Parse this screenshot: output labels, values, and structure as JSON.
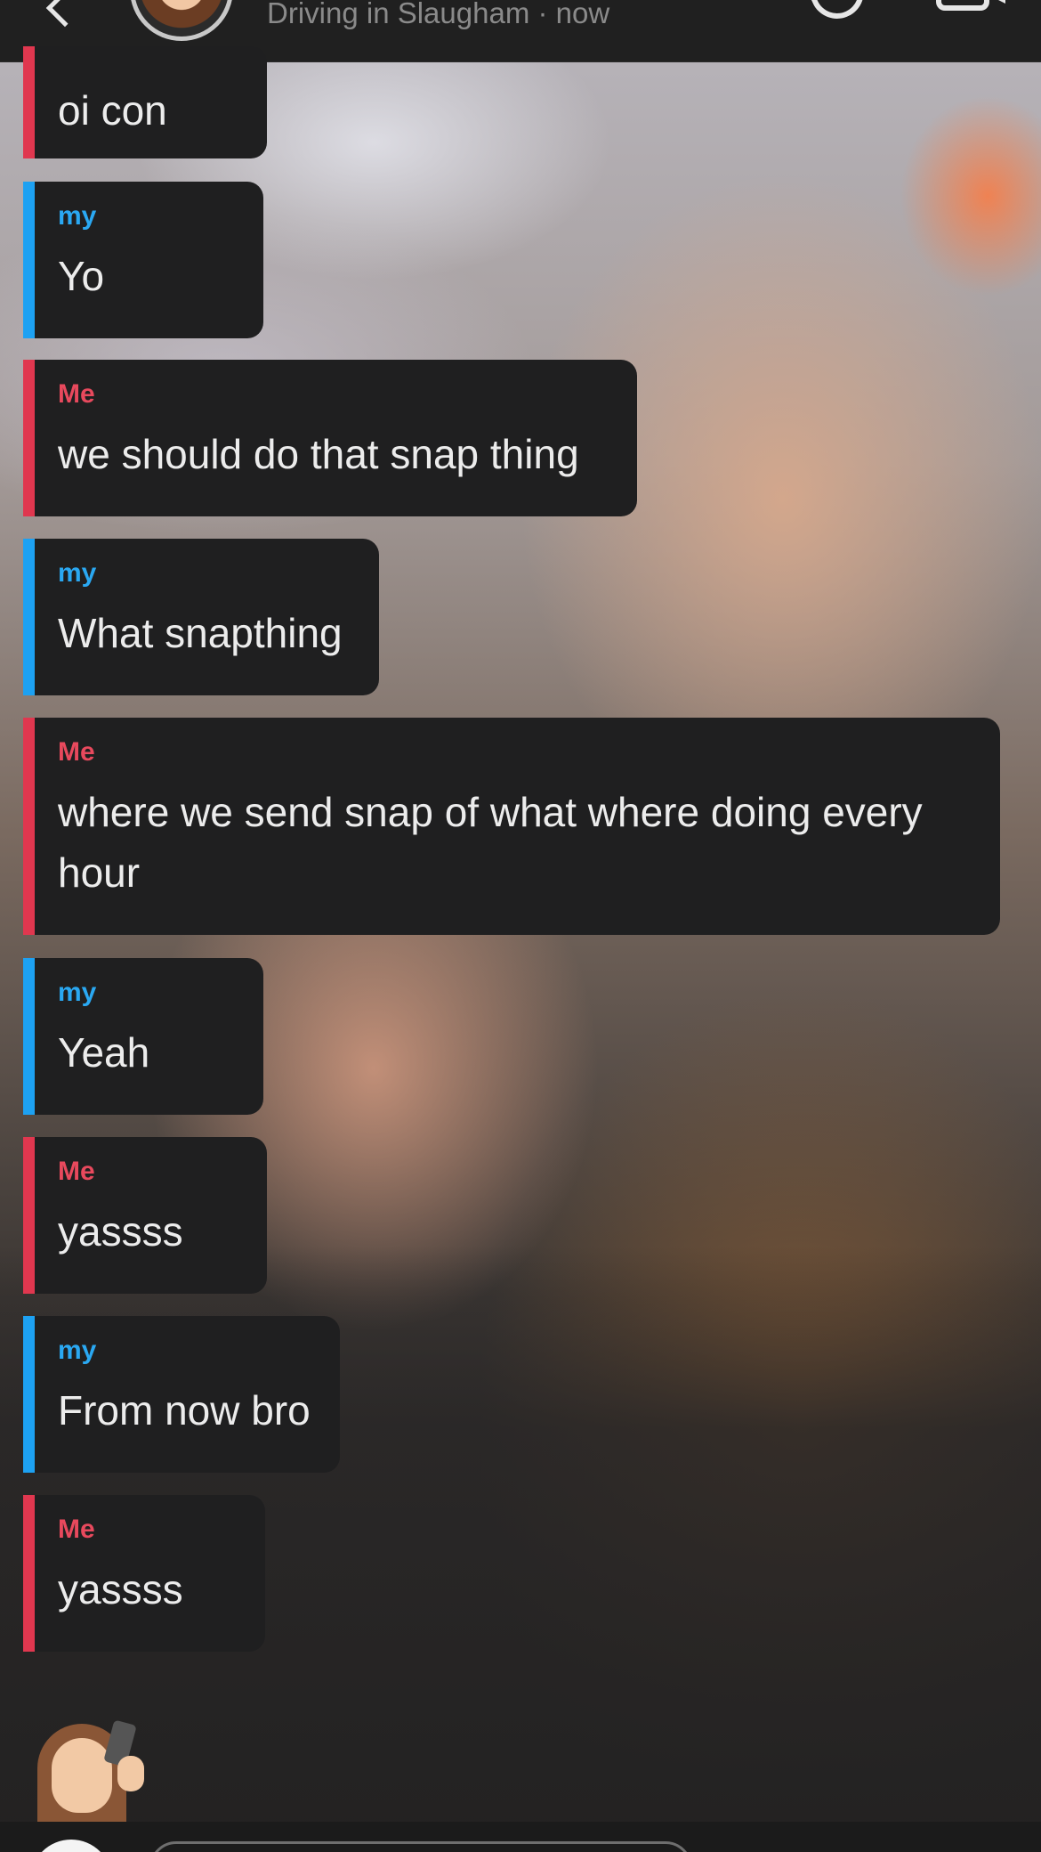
{
  "header": {
    "status": "Driving in Slaugham · now"
  },
  "messages": [
    {
      "sender": "",
      "text": "oi con",
      "from": "me"
    },
    {
      "sender": "my",
      "text": "Yo",
      "from": "friend"
    },
    {
      "sender": "Me",
      "text": "we should do that snap thing",
      "from": "me"
    },
    {
      "sender": "my",
      "text": "What snapthing",
      "from": "friend"
    },
    {
      "sender": "Me",
      "text": "where we send snap of what where doing every hour",
      "from": "me"
    },
    {
      "sender": "my",
      "text": "Yeah",
      "from": "friend"
    },
    {
      "sender": "Me",
      "text": "yassss",
      "from": "me"
    },
    {
      "sender": "my",
      "text": "From now bro",
      "from": "friend"
    },
    {
      "sender": "Me",
      "text": "yassss",
      "from": "me"
    }
  ],
  "colors": {
    "me_accent": "#e0374f",
    "friend_accent": "#1da1f2",
    "bubble_bg": "#1f1f20"
  },
  "icons": {
    "back": "chevron-left-icon",
    "call": "phone-icon",
    "video": "video-camera-icon"
  }
}
